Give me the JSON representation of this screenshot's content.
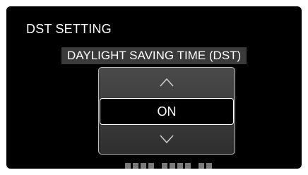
{
  "header": {
    "title": "DST SETTING"
  },
  "setting": {
    "name": "DAYLIGHT SAVING TIME (DST)"
  },
  "selector": {
    "value": "ON",
    "up_icon": "chevron-up-icon",
    "down_icon": "chevron-down-icon"
  },
  "colors": {
    "background": "#000000",
    "panel": "#3a3a3a",
    "text": "#ffffff",
    "highlight_border": "#ffffff"
  }
}
